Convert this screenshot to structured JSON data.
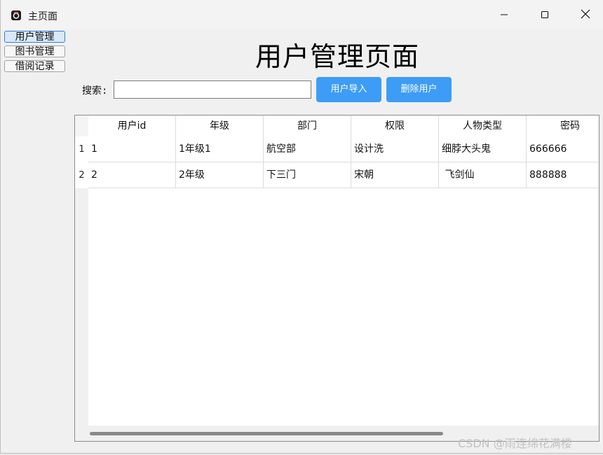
{
  "window": {
    "title": "主页面"
  },
  "sidebar": {
    "items": [
      {
        "label": "用户管理"
      },
      {
        "label": "图书管理"
      },
      {
        "label": "借阅记录"
      }
    ]
  },
  "main": {
    "page_title": "用户管理页面",
    "search": {
      "label": "搜索:",
      "value": "",
      "placeholder": ""
    },
    "buttons": {
      "import_label": "用户导入",
      "delete_label": "删除用户"
    },
    "table": {
      "columns": [
        "用户id",
        "年级",
        "部门",
        "权限",
        "人物类型",
        "密码"
      ],
      "row_numbers": [
        "1",
        "2"
      ],
      "rows": [
        [
          "1",
          "1年级1",
          "航空部",
          "设计洗",
          "细脖大头鬼",
          "666666"
        ],
        [
          "2",
          "2年级",
          "下三门",
          "宋朝",
          " 飞剑仙",
          "888888"
        ]
      ]
    }
  },
  "watermark": "CSDN @雨连绵花满楼",
  "colors": {
    "accent_button": "#3d9cf5",
    "active_nav_border": "#2f7fd6",
    "active_nav_bg": "#d8e9fb"
  },
  "icons": {
    "app": "app-icon",
    "minimize": "minimize-icon",
    "maximize": "maximize-icon",
    "close": "close-icon"
  }
}
